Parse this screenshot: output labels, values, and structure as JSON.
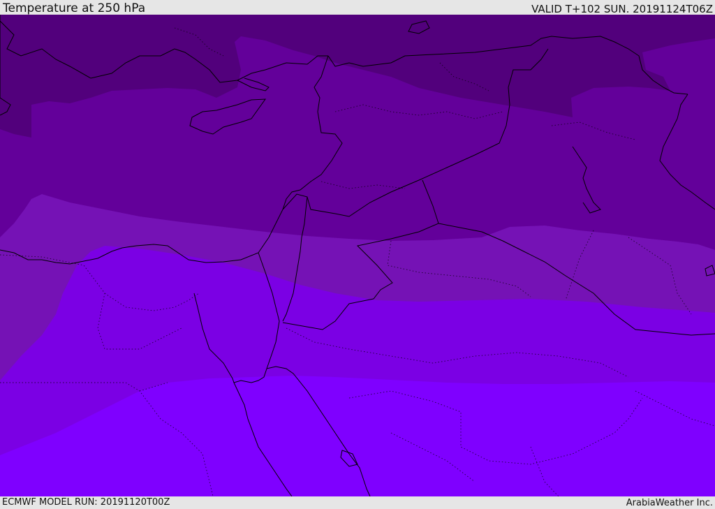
{
  "header": {
    "title": "Temperature at 250 hPa",
    "valid_time": "VALID T+102 SUN. 20191124T06Z"
  },
  "footer": {
    "model_run": "ECMWF MODEL RUN: 20191120T00Z",
    "credit": "ArabiaWeather Inc."
  },
  "map": {
    "variable": "temperature",
    "pressure_level_hpa": 250,
    "fill_colors": {
      "band_coldest": "#52007c",
      "band_2": "#63009a",
      "band_3": "#7512b5",
      "band_4": "#7b00e4",
      "band_warmest": "#7f00ff"
    },
    "boundary_color": "#000000"
  }
}
